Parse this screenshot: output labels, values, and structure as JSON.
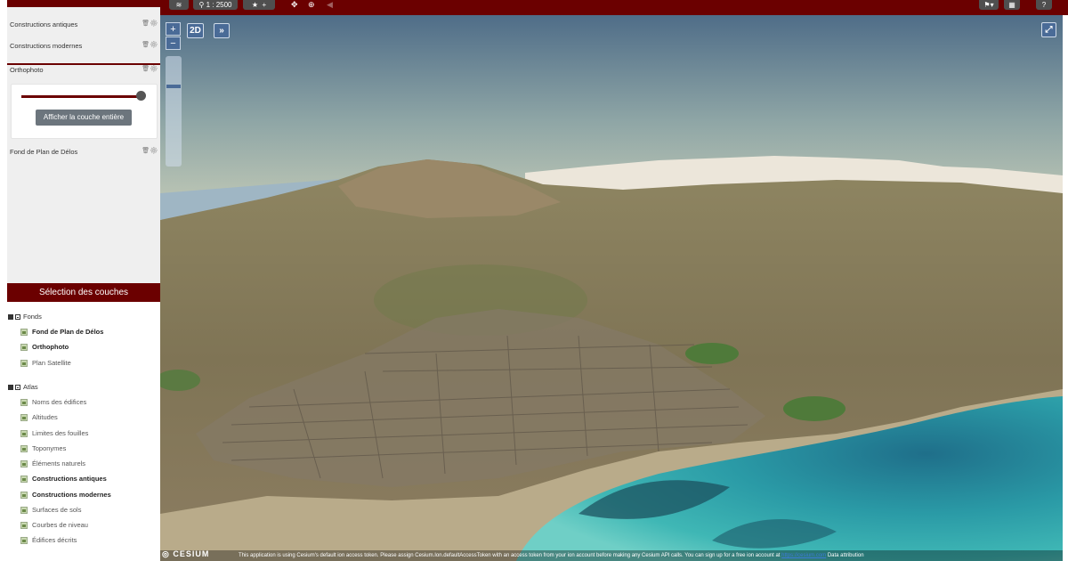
{
  "toolbar": {
    "scale_label": "1 : 2500",
    "favorite_plus": "+",
    "icons": [
      "layers-icon",
      "search-icon",
      "star-icon",
      "move-icon",
      "add-icon",
      "back-icon",
      "flag-icon",
      "map-icon",
      "help-icon"
    ]
  },
  "colors": {
    "accent": "#6b0000",
    "button_gray": "#4f4f4f",
    "map_control_blue": "#4a6b97"
  },
  "active_layers": [
    {
      "name": "Constructions antiques"
    },
    {
      "name": "Constructions modernes"
    },
    {
      "name": "Orthophoto"
    },
    {
      "name": "Fond de Plan de Délos"
    }
  ],
  "orthophoto_opacity": 1.0,
  "show_full_layer_button": "Afficher la couche entière",
  "selection": {
    "title": "Sélection des couches",
    "groups": [
      {
        "name": "Fonds",
        "items": [
          {
            "label": "Fond de Plan de Délos",
            "active": true
          },
          {
            "label": "Orthophoto",
            "active": true
          },
          {
            "label": "Plan Satellite",
            "active": false
          }
        ]
      },
      {
        "name": "Atlas",
        "items": [
          {
            "label": "Noms des édifices",
            "active": false
          },
          {
            "label": "Altitudes",
            "active": false
          },
          {
            "label": "Limites des fouilles",
            "active": false
          },
          {
            "label": "Toponymes",
            "active": false
          },
          {
            "label": "Éléments naturels",
            "active": false
          },
          {
            "label": "Constructions antiques",
            "active": true
          },
          {
            "label": "Constructions modernes",
            "active": true
          },
          {
            "label": "Surfaces de sols",
            "active": false
          },
          {
            "label": "Courbes de niveau",
            "active": false
          },
          {
            "label": "Édifices décrits",
            "active": false
          }
        ]
      }
    ]
  },
  "map": {
    "zoom_in": "+",
    "zoom_out": "−",
    "mode_button": "2D",
    "expand_button": "»",
    "zoom_level": 0.27,
    "cesium_logo": "CESIUM",
    "credit_text": "This application is using Cesium's default ion access token. Please assign Cesium.Ion.defaultAccessToken with an access token from your ion account before making any Cesium API calls. You can sign up for a free ion account at",
    "credit_link": "https://cesium.com",
    "data_attribution": "Data attribution"
  }
}
